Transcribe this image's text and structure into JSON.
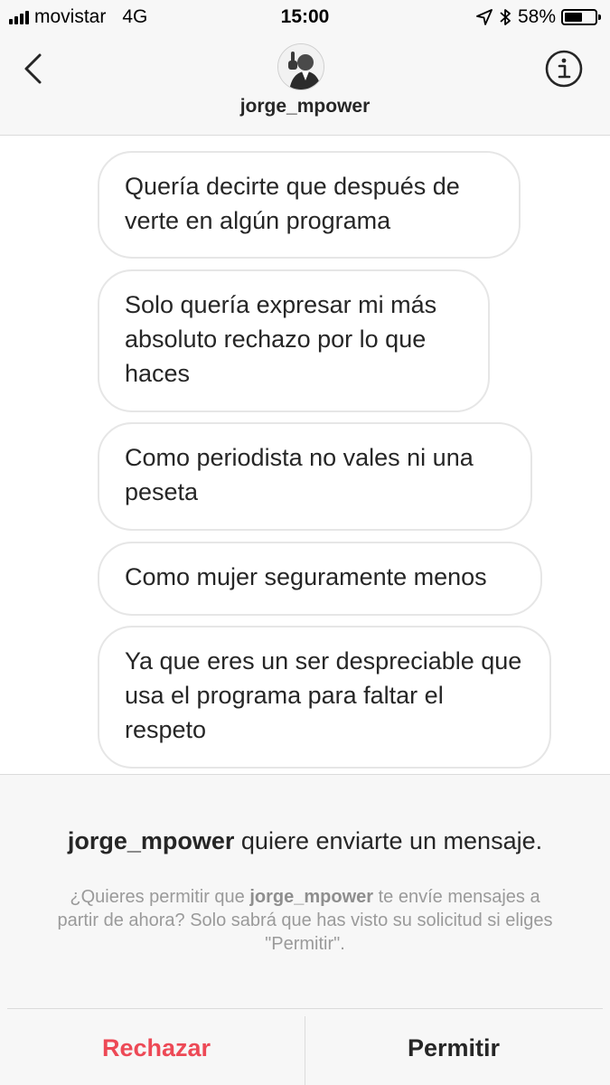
{
  "status_bar": {
    "carrier": "movistar",
    "network": "4G",
    "time": "15:00",
    "battery_text": "58%",
    "battery_level": 0.58,
    "signal_bars": 4,
    "icons": [
      "signal-icon",
      "location-arrow-icon",
      "bluetooth-icon",
      "battery-icon"
    ]
  },
  "header": {
    "username": "jorge_mpower",
    "icons": [
      "back-chevron-icon",
      "avatar",
      "info-icon"
    ]
  },
  "messages": [
    {
      "text": "Quería decirte que después de verte en algún programa"
    },
    {
      "text": "Solo quería expresar mi más absoluto rechazo por lo que haces"
    },
    {
      "text": "Como periodista no vales ni una peseta"
    },
    {
      "text": "Como mujer seguramente menos"
    },
    {
      "text": "Ya que eres un ser despreciable que usa el programa para faltar el respeto"
    }
  ],
  "request": {
    "title_user": "jorge_mpower",
    "title_rest": " quiere enviarte un mensaje.",
    "desc_prefix": "¿Quieres permitir que ",
    "desc_user": "jorge_mpower",
    "desc_suffix": " te envíe mensajes a partir de ahora? Solo sabrá que has visto su solicitud si eliges \"Permitir\".",
    "reject_label": "Rechazar",
    "allow_label": "Permitir"
  },
  "colors": {
    "bar_background": "#f7f7f7",
    "bubble_border": "#e6e6e6",
    "reject": "#ed4956",
    "text": "#262626",
    "muted": "#9a9a9a"
  }
}
